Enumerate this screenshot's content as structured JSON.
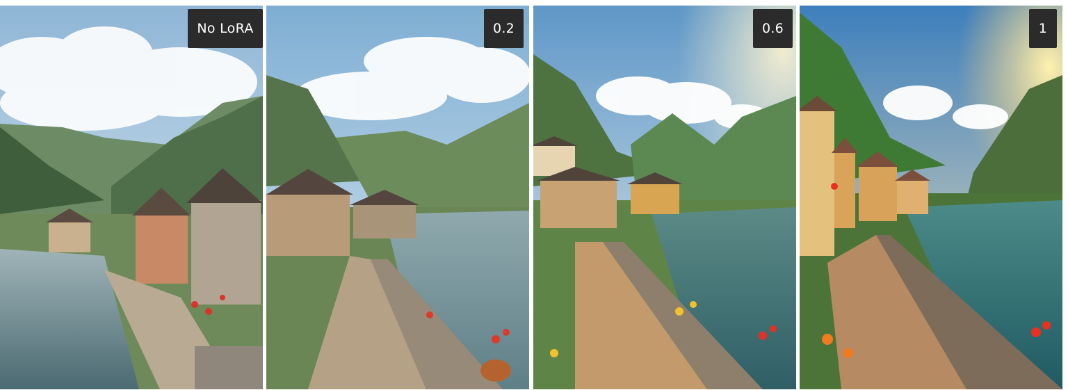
{
  "panels": [
    {
      "label": "No LoRA",
      "sky_top": "#8fb6d6",
      "sky_bottom": "#e3ecf2",
      "mountain_color": "#4f6f4a",
      "water_color": "#5d7d86",
      "path_color": "#b9aa94",
      "wall_color": "#8f877c",
      "flower_color": "#d8352a"
    },
    {
      "label": "0.2",
      "sky_top": "#7eaed3",
      "sky_bottom": "#dde9f1",
      "mountain_color": "#56744c",
      "water_color": "#6f8e96",
      "path_color": "#b5a186",
      "wall_color": "#978a78",
      "flower_color": "#dd3a2c"
    },
    {
      "label": "0.6",
      "sky_top": "#5f97c7",
      "sky_bottom": "#e8eef0",
      "mountain_color": "#4e7340",
      "water_color": "#3f6e70",
      "path_color": "#c29a6c",
      "wall_color": "#8d7f6c",
      "flower_color": "#e23226"
    },
    {
      "label": "1",
      "sky_top": "#3d7fbd",
      "sky_bottom": "#f4e2b8",
      "mountain_color": "#3f7a34",
      "water_color": "#2f6f74",
      "path_color": "#b68a62",
      "wall_color": "#7d6c5a",
      "flower_color": "#e9311f"
    }
  ]
}
